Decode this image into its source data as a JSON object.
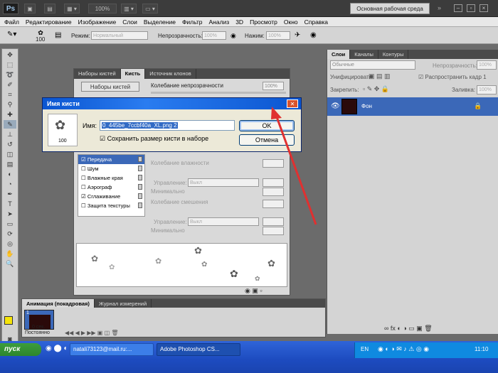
{
  "titlebar": {
    "logo": "Ps",
    "zoom": "100%",
    "workspace_button": "Основная рабочая среда"
  },
  "menu": [
    "Файл",
    "Редактирование",
    "Изображение",
    "Слои",
    "Выделение",
    "Фильтр",
    "Анализ",
    "3D",
    "Просмотр",
    "Окно",
    "Справка"
  ],
  "options": {
    "brush_size": "100",
    "mode_label": "Режим:",
    "mode_value": "Нормальный",
    "opacity_label": "Непрозрачность:",
    "opacity_value": "100%",
    "pressure_label": "Нажим:",
    "pressure_value": "100%"
  },
  "brush_panel": {
    "tabs": [
      "Наборы кистей",
      "Кисть",
      "Источник клонов"
    ],
    "presets_button": "Наборы кистей",
    "jitter_label": "Колебание непрозрачности",
    "jitter_value": "100%",
    "items": [
      {
        "label": "Передача",
        "checked": true,
        "selected": true
      },
      {
        "label": "Шум",
        "checked": false,
        "selected": false
      },
      {
        "label": "Влажные края",
        "checked": false,
        "selected": false
      },
      {
        "label": "Аэрограф",
        "checked": false,
        "selected": false
      },
      {
        "label": "Сглаживание",
        "checked": true,
        "selected": false
      },
      {
        "label": "Защита текстуры",
        "checked": false,
        "selected": false
      }
    ],
    "wet_jitter_label": "Колебание влажности",
    "control_label": "Управление:",
    "control_value": "Выкл",
    "minimum_label": "Минимально",
    "mix_jitter_label": "Колебание смешения",
    "control2_value": "Выкл",
    "minimum2_label": "Минимально"
  },
  "dialog": {
    "title": "Имя кисти",
    "thumbnail_size": "100",
    "name_label": "Имя:",
    "name_value": "0_445be_7ccbf40a_XL.png 2",
    "checkbox_label": "Сохранить размер кисти в наборе",
    "checkbox_checked": true,
    "ok_button": "OK",
    "cancel_button": "Отмена"
  },
  "layers_panel": {
    "tabs": [
      "Слои",
      "Каналы",
      "Контуры"
    ],
    "blend_mode": "Обычные",
    "opacity_label": "Непрозрачность:",
    "opacity_value": "100%",
    "unify_label": "Унифицировать:",
    "spread_label": "Распространить кадр 1",
    "lock_label": "Закрепить:",
    "fill_label": "Заливка:",
    "fill_value": "100%",
    "layer_name": "Фон"
  },
  "anim_panel": {
    "tabs": [
      "Анимация (покадровая)",
      "Журнал измерений"
    ],
    "frame_number": "1",
    "frame_time": "0 сек.",
    "loop_value": "Постоянно"
  },
  "taskbar": {
    "start": "пуск",
    "items": [
      "natali73123@mail.ru:...",
      "Adobe Photoshop CS..."
    ],
    "lang": "EN",
    "clock": "11:10"
  },
  "colors": {
    "foreground": "#f5e40a",
    "accent": "#3b68b8",
    "arrow": "#e03030"
  }
}
